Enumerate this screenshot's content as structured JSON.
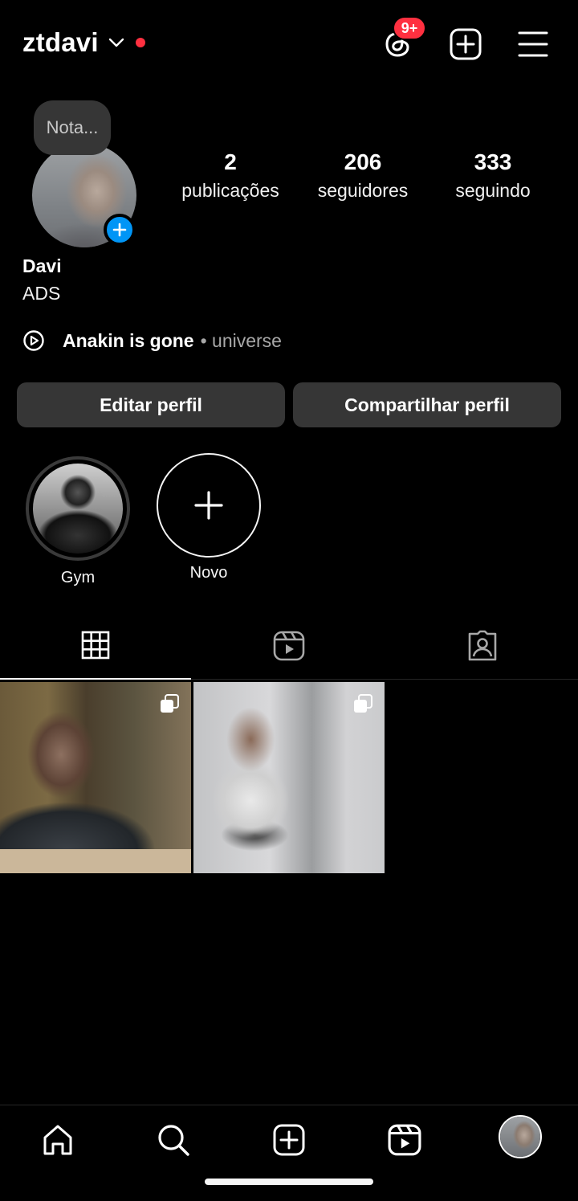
{
  "header": {
    "username": "ztdavi",
    "notification_badge": "9+",
    "accent_red": "#ff3040"
  },
  "note": {
    "placeholder": "Nota..."
  },
  "stats": {
    "posts_count": "2",
    "posts_label": "publicações",
    "followers_count": "206",
    "followers_label": "seguidores",
    "following_count": "333",
    "following_label": "seguindo"
  },
  "profile": {
    "name": "Davi",
    "bio": "ADS",
    "song_title": "Anakin is gone",
    "song_artist": "• universe"
  },
  "actions": {
    "edit_label": "Editar perfil",
    "share_label": "Compartilhar perfil"
  },
  "highlights": [
    {
      "label": "Gym"
    },
    {
      "label": "Novo"
    }
  ],
  "tabs": [
    "grid-icon",
    "reels-icon",
    "tagged-icon"
  ],
  "icons": {
    "top": [
      "threads-icon",
      "add-icon",
      "menu-icon"
    ],
    "bottom_nav": [
      "home-icon",
      "search-icon",
      "create-icon",
      "reels-icon",
      "profile-avatar"
    ]
  },
  "colors": {
    "background": "#000000",
    "button_bg": "#363636",
    "link_blue": "#0095f6"
  }
}
